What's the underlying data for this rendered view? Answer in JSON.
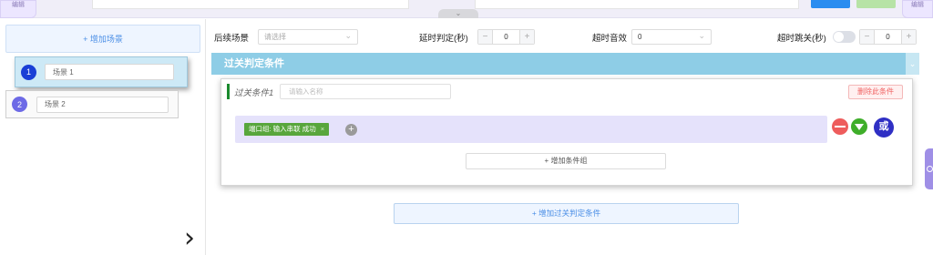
{
  "topbar": {
    "left_edit_label": "编辑",
    "right_edit_label": "编辑",
    "collapse_icon": "chevron-down-icon"
  },
  "left_panel": {
    "add_scene_label": "+ 增加场景",
    "scenes": [
      {
        "number": "1",
        "name": "场景 1",
        "active": true
      },
      {
        "number": "2",
        "name": "场景 2",
        "active": false
      }
    ],
    "next_icon": "chevron-right-icon"
  },
  "settings": {
    "next_scene_label": "后续场景",
    "next_scene_placeholder": "请选择",
    "delay_label": "延时判定(秒)",
    "delay_value": "0",
    "timeout_sound_label": "超时音效",
    "timeout_sound_value": "0",
    "timeout_skip_label": "超时跳关(秒)",
    "timeout_skip_value": "0",
    "timeout_skip_enabled": false
  },
  "pass_conditions": {
    "header": "过关判定条件",
    "conditions": [
      {
        "title": "过关条件1",
        "name_placeholder": "请输入名称",
        "delete_label": "删除此条件",
        "groups": [
          {
            "tags": [
              {
                "label": "端口组: 输入串联 成功",
                "remove": "×"
              }
            ],
            "add_tag": "+"
          }
        ],
        "or_label": "或",
        "add_group_label": "+ 增加条件组"
      }
    ],
    "add_condition_label": "+ 增加过关判定条件"
  },
  "colors": {
    "header_bg": "#8ecde6",
    "tag_bg": "#58a63c",
    "active_scene_bg": "#cde9f6",
    "delete_red": "#f06464"
  }
}
